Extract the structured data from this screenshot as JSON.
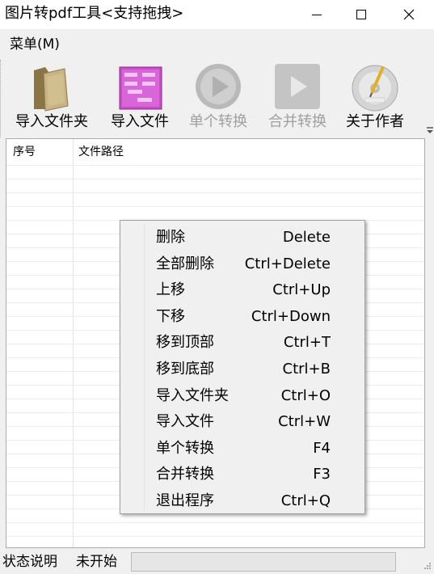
{
  "window": {
    "title": "图片转pdf工具<支持拖拽>"
  },
  "menu": {
    "label": "菜单(M)"
  },
  "toolbar": {
    "buttons": [
      {
        "label": "导入文件夹",
        "icon": "folder-icon",
        "enabled": true
      },
      {
        "label": "导入文件",
        "icon": "image-files-icon",
        "enabled": true
      },
      {
        "label": "单个转换",
        "icon": "play-circle-icon",
        "enabled": false
      },
      {
        "label": "合并转换",
        "icon": "play-square-icon",
        "enabled": false
      },
      {
        "label": "关于作者",
        "icon": "writer-disc-icon",
        "enabled": true
      }
    ]
  },
  "list": {
    "columns": [
      "序号",
      "文件路径"
    ],
    "rows": []
  },
  "context_menu": {
    "items": [
      {
        "label": "删除",
        "shortcut": "Delete"
      },
      {
        "label": "全部删除",
        "shortcut": "Ctrl+Delete"
      },
      {
        "label": "上移",
        "shortcut": "Ctrl+Up"
      },
      {
        "label": "下移",
        "shortcut": "Ctrl+Down"
      },
      {
        "label": "移到顶部",
        "shortcut": "Ctrl+T"
      },
      {
        "label": "移到底部",
        "shortcut": "Ctrl+B"
      },
      {
        "label": "导入文件夹",
        "shortcut": "Ctrl+O"
      },
      {
        "label": "导入文件",
        "shortcut": "Ctrl+W"
      },
      {
        "label": "单个转换",
        "shortcut": "F4"
      },
      {
        "label": "合并转换",
        "shortcut": "F3"
      },
      {
        "label": "退出程序",
        "shortcut": "Ctrl+Q"
      }
    ]
  },
  "status": {
    "caption": "状态说明",
    "value": "未开始"
  },
  "colors": {
    "disabled_text": "#a0a0a0",
    "image_icon": "#c040c0",
    "window_bg": "#f0f0f0"
  }
}
